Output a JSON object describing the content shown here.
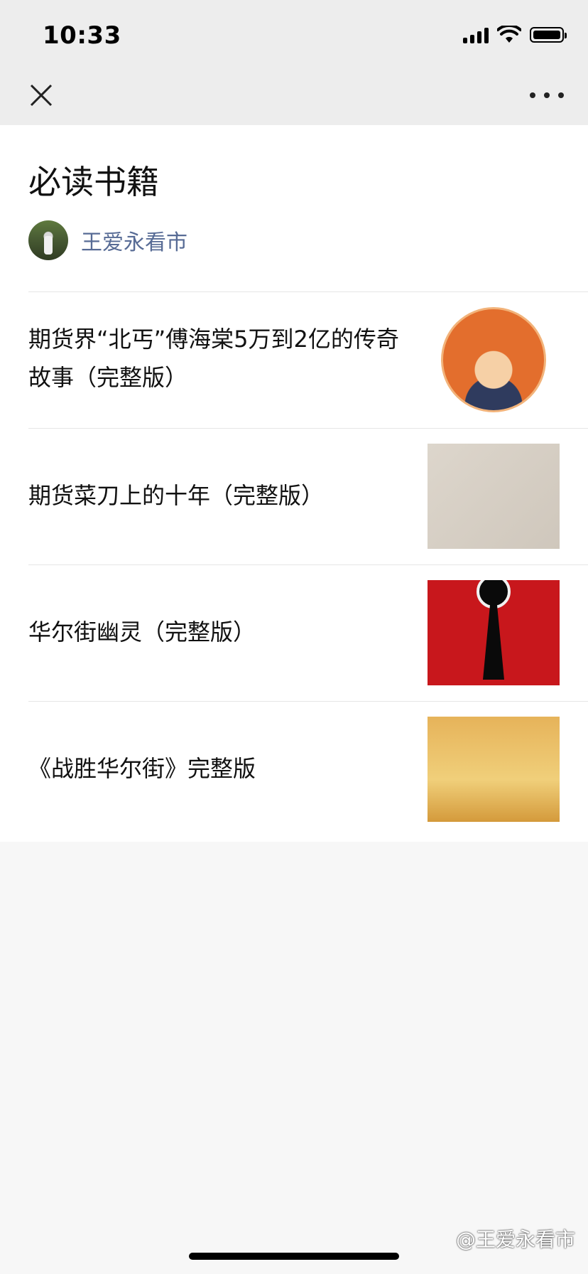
{
  "status_bar": {
    "time": "10:33"
  },
  "nav": {
    "close_icon": "close-icon",
    "more_icon": "more-icon"
  },
  "page": {
    "title": "必读书籍",
    "author": "王爱永看市",
    "items": [
      {
        "title": "期货界“北丐”傅海棠5万到2亿的传奇故事（完整版）",
        "thumb": "book-cover-1"
      },
      {
        "title": "期货菜刀上的十年（完整版）",
        "thumb": "book-cover-2"
      },
      {
        "title": "华尔街幽灵（完整版）",
        "thumb": "book-cover-3"
      },
      {
        "title": "《战胜华尔街》完整版",
        "thumb": "book-cover-4"
      }
    ]
  },
  "watermark": "@王爱永看市",
  "colors": {
    "link": "#576b95",
    "nav_bg": "#ededed",
    "bg": "#f7f7f7"
  }
}
